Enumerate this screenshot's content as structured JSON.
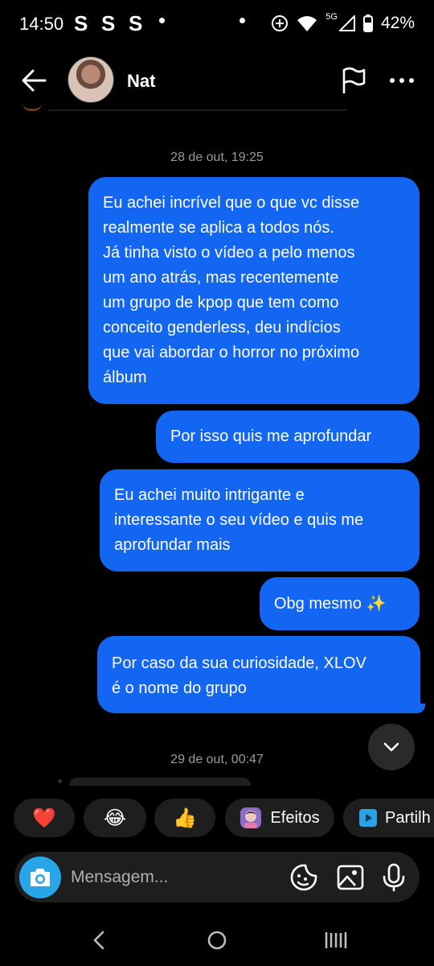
{
  "status_bar": {
    "time": "14:50",
    "s_icons": [
      "S",
      "S",
      "S"
    ],
    "network": "5G",
    "battery": "42%"
  },
  "header": {
    "contact_name": "Nat"
  },
  "messages": {
    "timestamp_1": "28 de out, 19:25",
    "sent": [
      {
        "lines": [
          "Eu achei incrível que o que vc disse",
          "realmente se aplica a todos nós.",
          "Já tinha visto o vídeo a pelo menos",
          "um ano atrás, mas recentemente",
          "um grupo de kpop que tem como",
          "conceito genderless, deu indícios",
          "que vai abordar o horror no próximo",
          "álbum"
        ]
      },
      {
        "lines": [
          "Por isso quis me aprofundar"
        ]
      },
      {
        "lines": [
          "Eu achei muito intrigante e",
          "interessante o seu vídeo e quis me",
          "aprofundar mais"
        ]
      },
      {
        "lines": [
          "Obg mesmo ✨"
        ]
      },
      {
        "lines": [
          "Por caso da sua curiosidade, XLOV",
          "é o nome do grupo"
        ]
      }
    ],
    "timestamp_2": "29 de out, 00:47"
  },
  "quick_reactions": {
    "heart": "❤️",
    "laugh": "😂",
    "thumbs_up": "👍",
    "effects_label": "Efeitos",
    "share_label": "Partilh"
  },
  "composer": {
    "placeholder": "Mensagem..."
  },
  "colors": {
    "bubble": "#1266f1",
    "camera": "#28a6e9",
    "background": "#000000"
  }
}
